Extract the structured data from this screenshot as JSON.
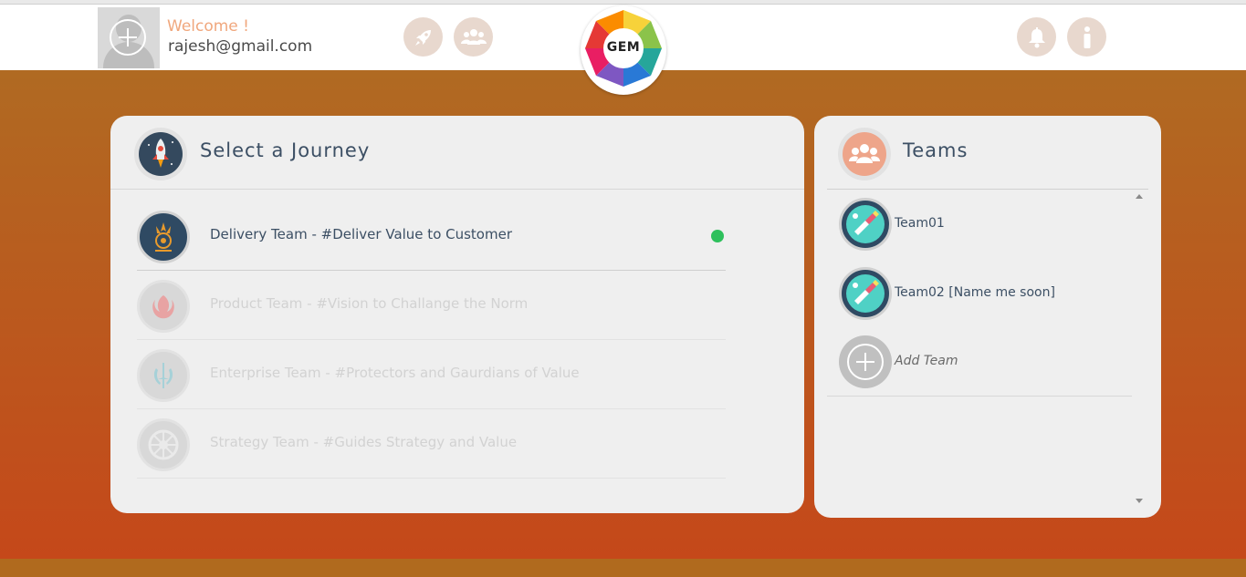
{
  "header": {
    "welcome": "Welcome !",
    "email": "rajesh@gmail.com",
    "logo_text": "GEM",
    "nav_icons": [
      "rocket-icon",
      "users-icon"
    ],
    "action_icons": [
      "bell-icon",
      "info-icon"
    ]
  },
  "journey": {
    "title": "Select a Journey",
    "items": [
      {
        "label": "Delivery Team - #Deliver Value to Customer",
        "state": "active",
        "icon": "galactic-empire-icon"
      },
      {
        "label": "Product Team - #Vision to Challange the Norm",
        "state": "disabled",
        "icon": "rebel-alliance-icon"
      },
      {
        "label": "Enterprise Team - #Protectors and Gaurdians of Value",
        "state": "disabled",
        "icon": "jedi-order-icon"
      },
      {
        "label": "Strategy Team - #Guides Strategy and Value",
        "state": "disabled",
        "icon": "imperial-cog-icon"
      }
    ]
  },
  "teams": {
    "title": "Teams",
    "items": [
      {
        "label": "Team01"
      },
      {
        "label": "Team02 [Name me soon]"
      }
    ],
    "add_label": "Add Team"
  },
  "colors": {
    "accent_orange": "#f0a77d",
    "text_dark": "#3c4f64",
    "status_green": "#2ec05c",
    "bg_top": "#b06a22",
    "bg_bottom": "#c5481a"
  }
}
